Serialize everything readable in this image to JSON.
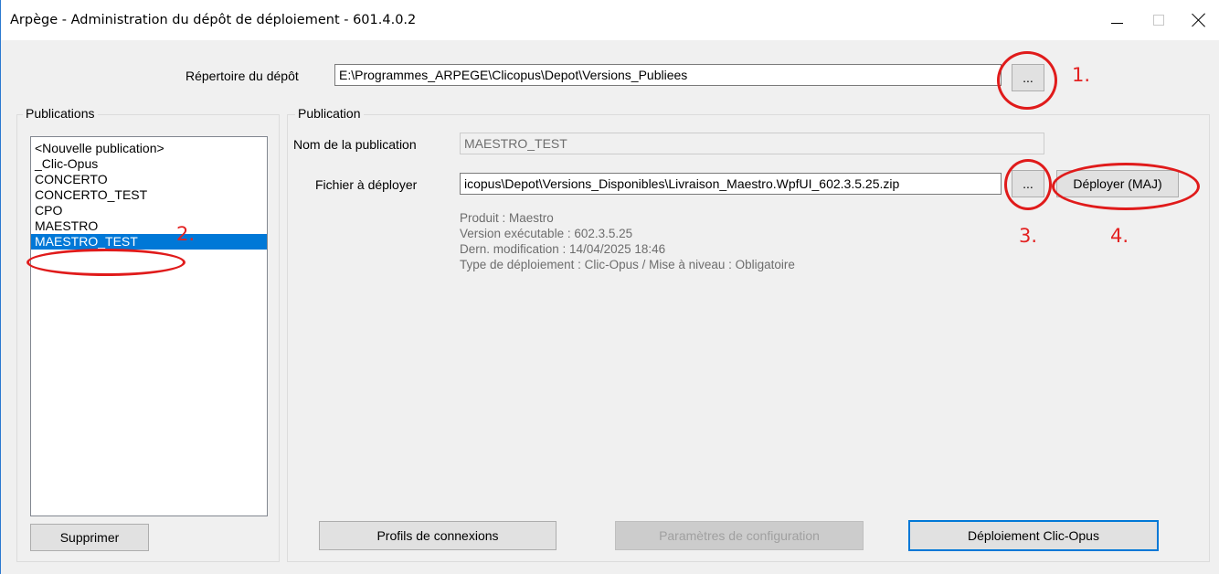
{
  "window": {
    "title": "Arpège - Administration du dépôt de déploiement - 601.4.0.2"
  },
  "depot": {
    "label": "Répertoire du dépôt",
    "path": "E:\\Programmes_ARPEGE\\Clicopus\\Depot\\Versions_Publiees",
    "browse_label": "..."
  },
  "publications": {
    "group_title": "Publications",
    "items": [
      "<Nouvelle publication>",
      "_Clic-Opus",
      "CONCERTO",
      "CONCERTO_TEST",
      "CPO",
      "MAESTRO",
      "MAESTRO_TEST"
    ],
    "selected": "MAESTRO_TEST",
    "delete_label": "Supprimer"
  },
  "publication": {
    "group_title": "Publication",
    "name_label": "Nom de la publication",
    "name_value": "MAESTRO_TEST",
    "file_label": "Fichier à déployer",
    "file_value": "icopus\\Depot\\Versions_Disponibles\\Livraison_Maestro.WpfUI_602.3.5.25.zip",
    "browse_label": "...",
    "deploy_label": "Déployer (MAJ)",
    "info": [
      "Produit : Maestro",
      "Version exécutable : 602.3.5.25",
      "Dern. modification : 14/04/2025 18:46",
      "Type de déploiement : Clic-Opus / Mise à niveau : Obligatoire"
    ]
  },
  "buttons": {
    "profiles": "Profils de connexions",
    "config": "Paramètres de configuration",
    "deploy_clicopus": "Déploiement Clic-Opus"
  },
  "annotations": [
    "1.",
    "2.",
    "3.",
    "4."
  ],
  "colors": {
    "accent": "#0078d7",
    "annotation": "#e01b1b"
  }
}
